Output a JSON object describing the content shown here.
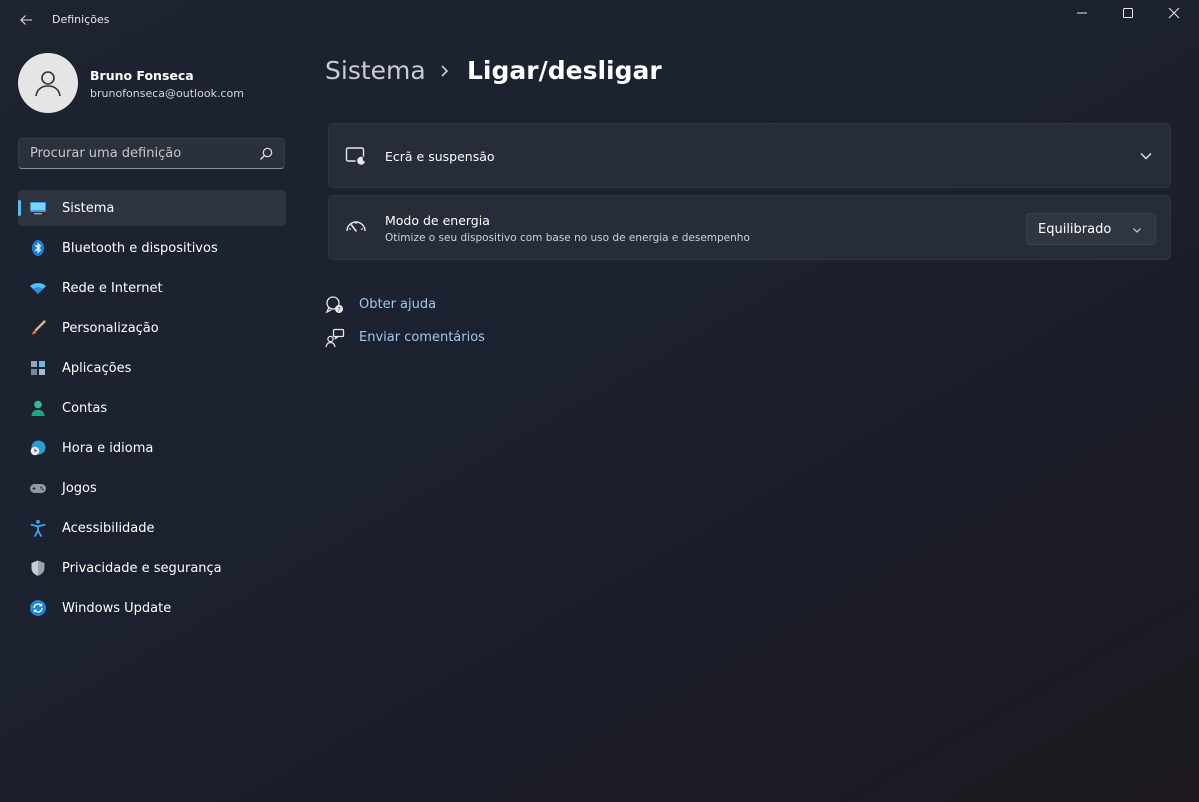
{
  "window": {
    "title": "Definições"
  },
  "user": {
    "name": "Bruno Fonseca",
    "email": "brunofonseca@outlook.com"
  },
  "search": {
    "placeholder": "Procurar uma definição"
  },
  "nav": {
    "items": [
      {
        "label": "Sistema",
        "icon": "system-icon",
        "active": true
      },
      {
        "label": "Bluetooth e dispositivos",
        "icon": "bluetooth-icon"
      },
      {
        "label": "Rede e Internet",
        "icon": "wifi-icon"
      },
      {
        "label": "Personalização",
        "icon": "brush-icon"
      },
      {
        "label": "Aplicações",
        "icon": "apps-icon"
      },
      {
        "label": "Contas",
        "icon": "person-icon"
      },
      {
        "label": "Hora e idioma",
        "icon": "globe-clock-icon"
      },
      {
        "label": "Jogos",
        "icon": "gamepad-icon"
      },
      {
        "label": "Acessibilidade",
        "icon": "accessibility-icon"
      },
      {
        "label": "Privacidade e segurança",
        "icon": "shield-icon"
      },
      {
        "label": "Windows Update",
        "icon": "update-icon"
      }
    ]
  },
  "breadcrumb": {
    "parent": "Sistema",
    "current": "Ligar/desligar"
  },
  "cards": {
    "display": {
      "title": "Ecrã e suspensão",
      "icon": "screen-sleep-icon"
    },
    "power": {
      "title": "Modo de energia",
      "subtitle": "Otimize o seu dispositivo com base no uso de energia e desempenho",
      "value": "Equilibrado",
      "icon": "gauge-icon"
    }
  },
  "links": {
    "help": "Obter ajuda",
    "feedback": "Enviar comentários"
  },
  "colors": {
    "accent": "#4cc2ff",
    "link": "#9cc9f0"
  }
}
